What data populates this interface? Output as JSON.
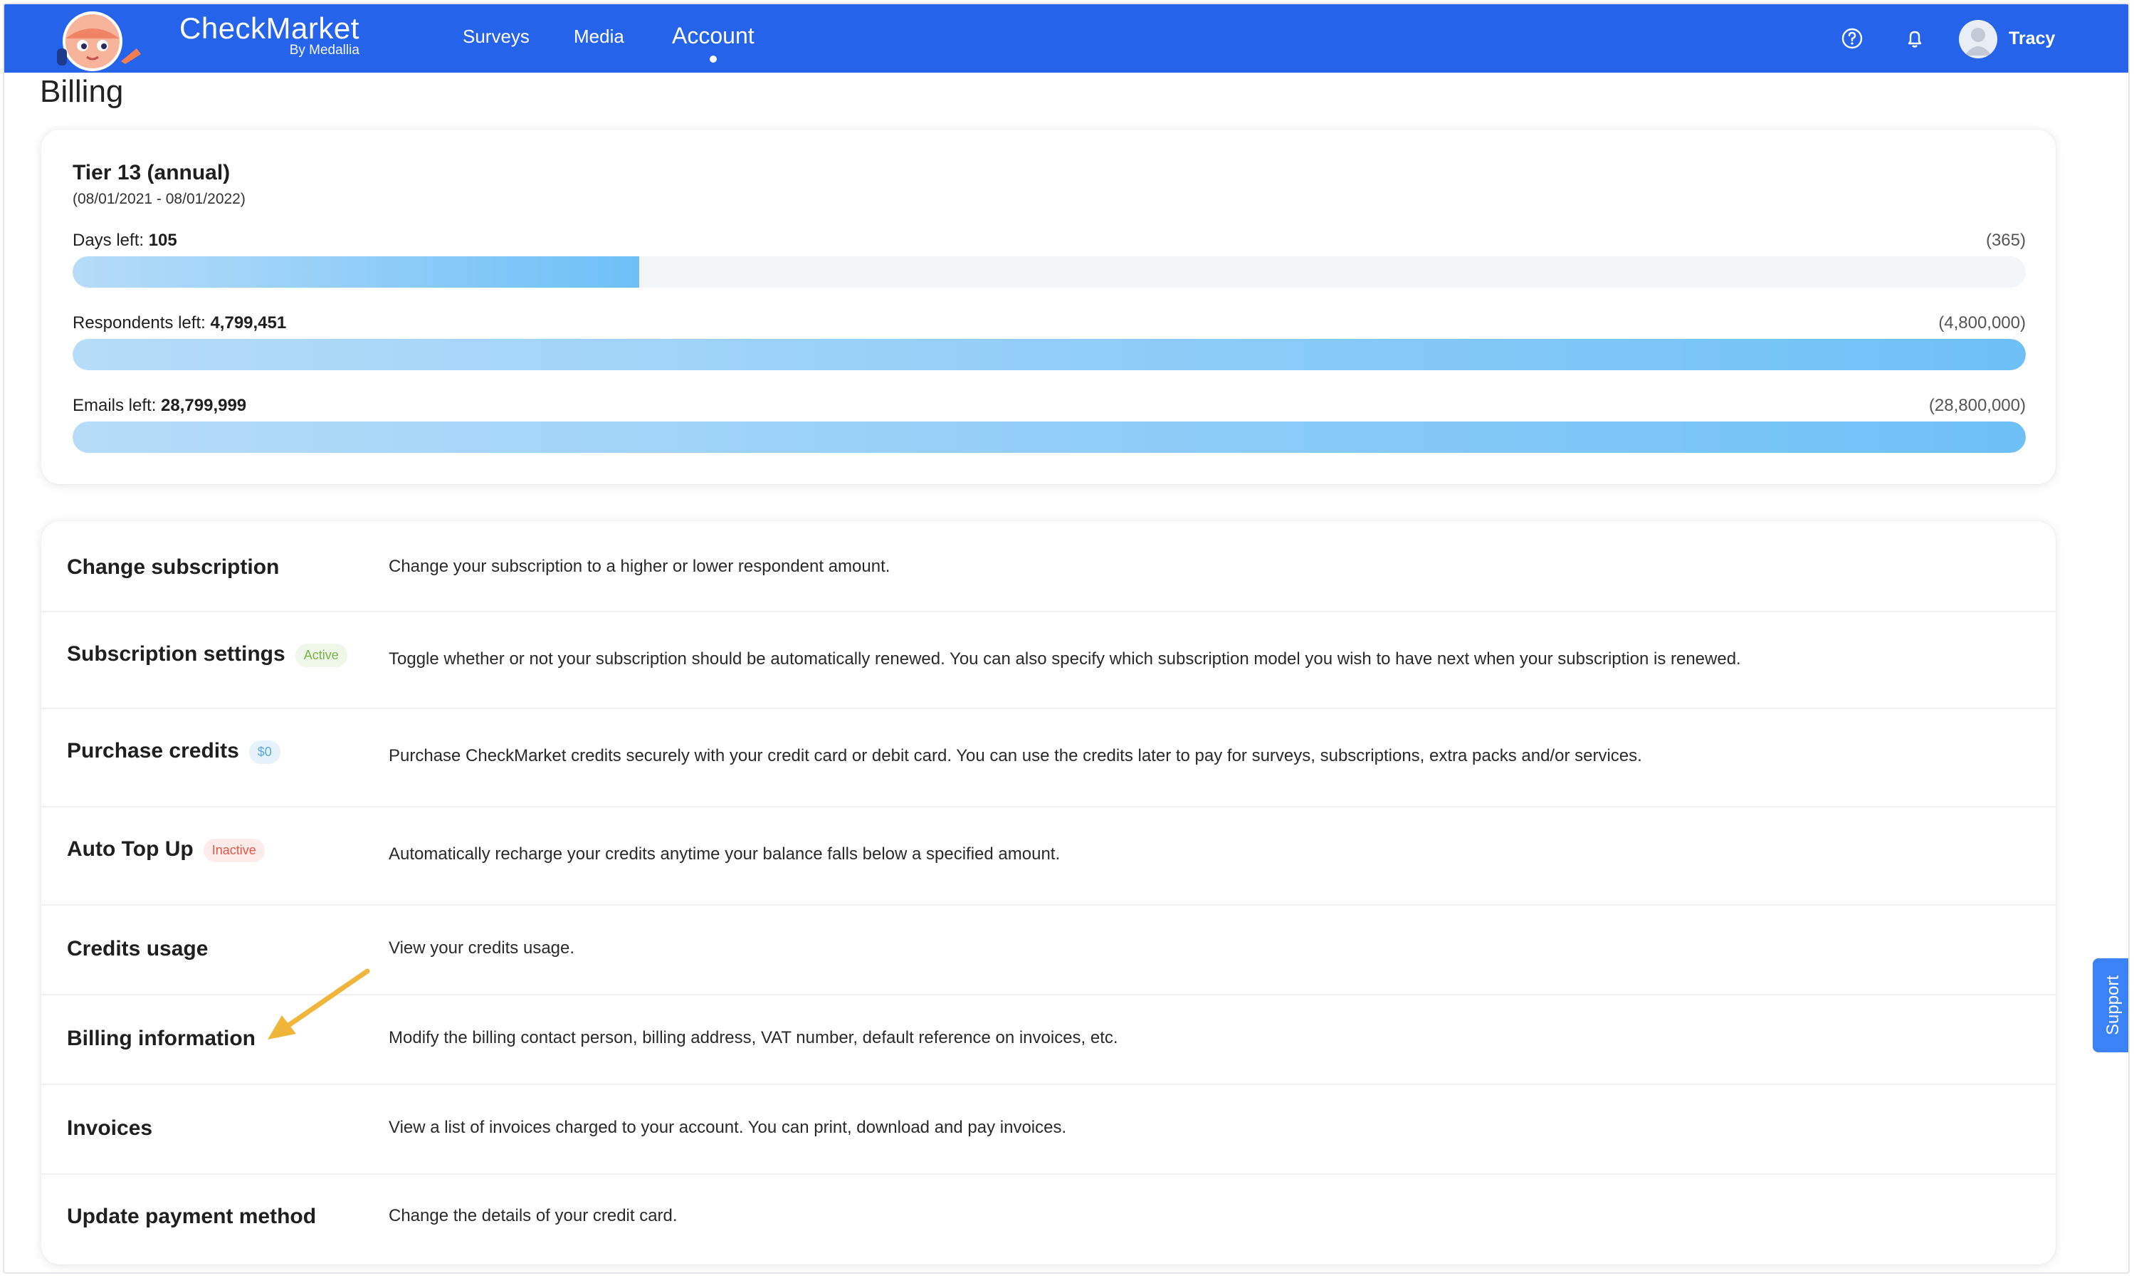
{
  "header": {
    "brand_name": "CheckMarket",
    "brand_sub": "By Medallia",
    "nav": [
      {
        "label": "Surveys"
      },
      {
        "label": "Media"
      },
      {
        "label": "Account"
      }
    ],
    "user_name": "Tracy",
    "icons": [
      "help-icon",
      "bell-icon",
      "avatar"
    ]
  },
  "page": {
    "title": "Billing"
  },
  "tier": {
    "title": "Tier 13 (annual)",
    "dates": "(08/01/2021 - 08/01/2022)",
    "meters": [
      {
        "label": "Days left: ",
        "value": "105",
        "total": "(365)",
        "fraction": 0.29
      },
      {
        "label": "Respondents left: ",
        "value": "4,799,451",
        "total": "(4,800,000)",
        "fraction": 0.9999
      },
      {
        "label": "Emails left: ",
        "value": "28,799,999",
        "total": "(28,800,000)",
        "fraction": 0.99999
      }
    ]
  },
  "options": [
    {
      "title": "Change subscription",
      "badge": "",
      "desc": "Change your subscription to a higher or lower respondent amount."
    },
    {
      "title": "Subscription settings",
      "badge": "Active",
      "desc": "Toggle whether or not your subscription should be automatically renewed. You can also specify which subscription model you wish to have next when your subscription is renewed."
    },
    {
      "title": "Purchase credits",
      "badge": "$0",
      "desc": "Purchase CheckMarket credits securely with your credit card or debit card. You can use the credits later to pay for surveys, subscriptions, extra packs and/or services."
    },
    {
      "title": "Auto Top Up",
      "badge": "Inactive",
      "desc": "Automatically recharge your credits anytime your balance falls below a specified amount."
    },
    {
      "title": "Credits usage",
      "badge": "",
      "desc": "View your credits usage."
    },
    {
      "title": "Billing information",
      "badge": "",
      "desc": "Modify the billing contact person, billing address, VAT number, default reference on invoices, etc."
    },
    {
      "title": "Invoices",
      "badge": "",
      "desc": "View a list of invoices charged to your account. You can print, download and pay invoices."
    },
    {
      "title": "Update payment method",
      "badge": "",
      "desc": "Change the details of your credit card."
    }
  ],
  "support": {
    "label": "Support"
  },
  "colors": {
    "primary": "#2563eb",
    "bar": "#6ec0f7",
    "arrow": "#f0b63c"
  }
}
